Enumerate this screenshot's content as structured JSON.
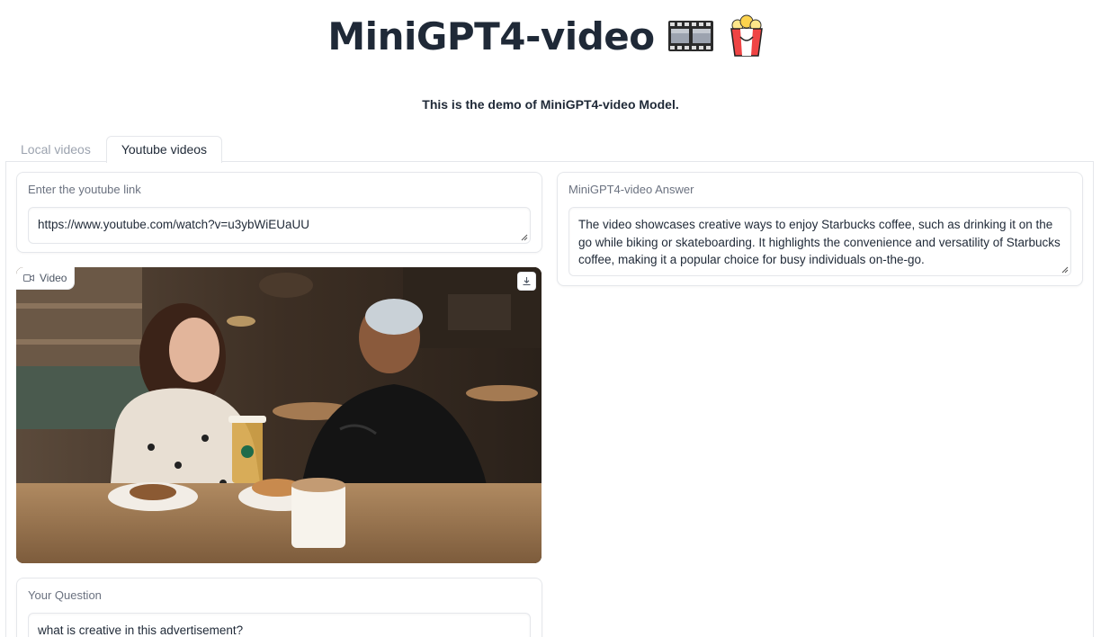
{
  "header": {
    "title": "MiniGPT4-video",
    "icons": [
      "film-frames-icon",
      "popcorn-icon"
    ],
    "subtitle": "This is the demo of MiniGPT4-video Model."
  },
  "tabs": [
    {
      "label": "Local videos",
      "selected": false
    },
    {
      "label": "Youtube videos",
      "selected": true
    }
  ],
  "youtube_link": {
    "label": "Enter the youtube link",
    "value": "https://www.youtube.com/watch?v=u3ybWiEUaUU"
  },
  "video": {
    "label": "Video",
    "download_icon": "download-icon"
  },
  "question": {
    "label": "Your Question",
    "value": "what is creative in this advertisement?"
  },
  "answer": {
    "label": "MiniGPT4-video Answer",
    "value": "The video showcases creative ways to enjoy Starbucks coffee, such as drinking it on the go while biking or skateboarding. It highlights the convenience and versatility of Starbucks coffee, making it a popular choice for busy individuals on-the-go."
  },
  "colors": {
    "border": "#e5e7eb",
    "label": "#6b7280",
    "text": "#1f2937",
    "inactive_tab": "#9ca3af"
  }
}
